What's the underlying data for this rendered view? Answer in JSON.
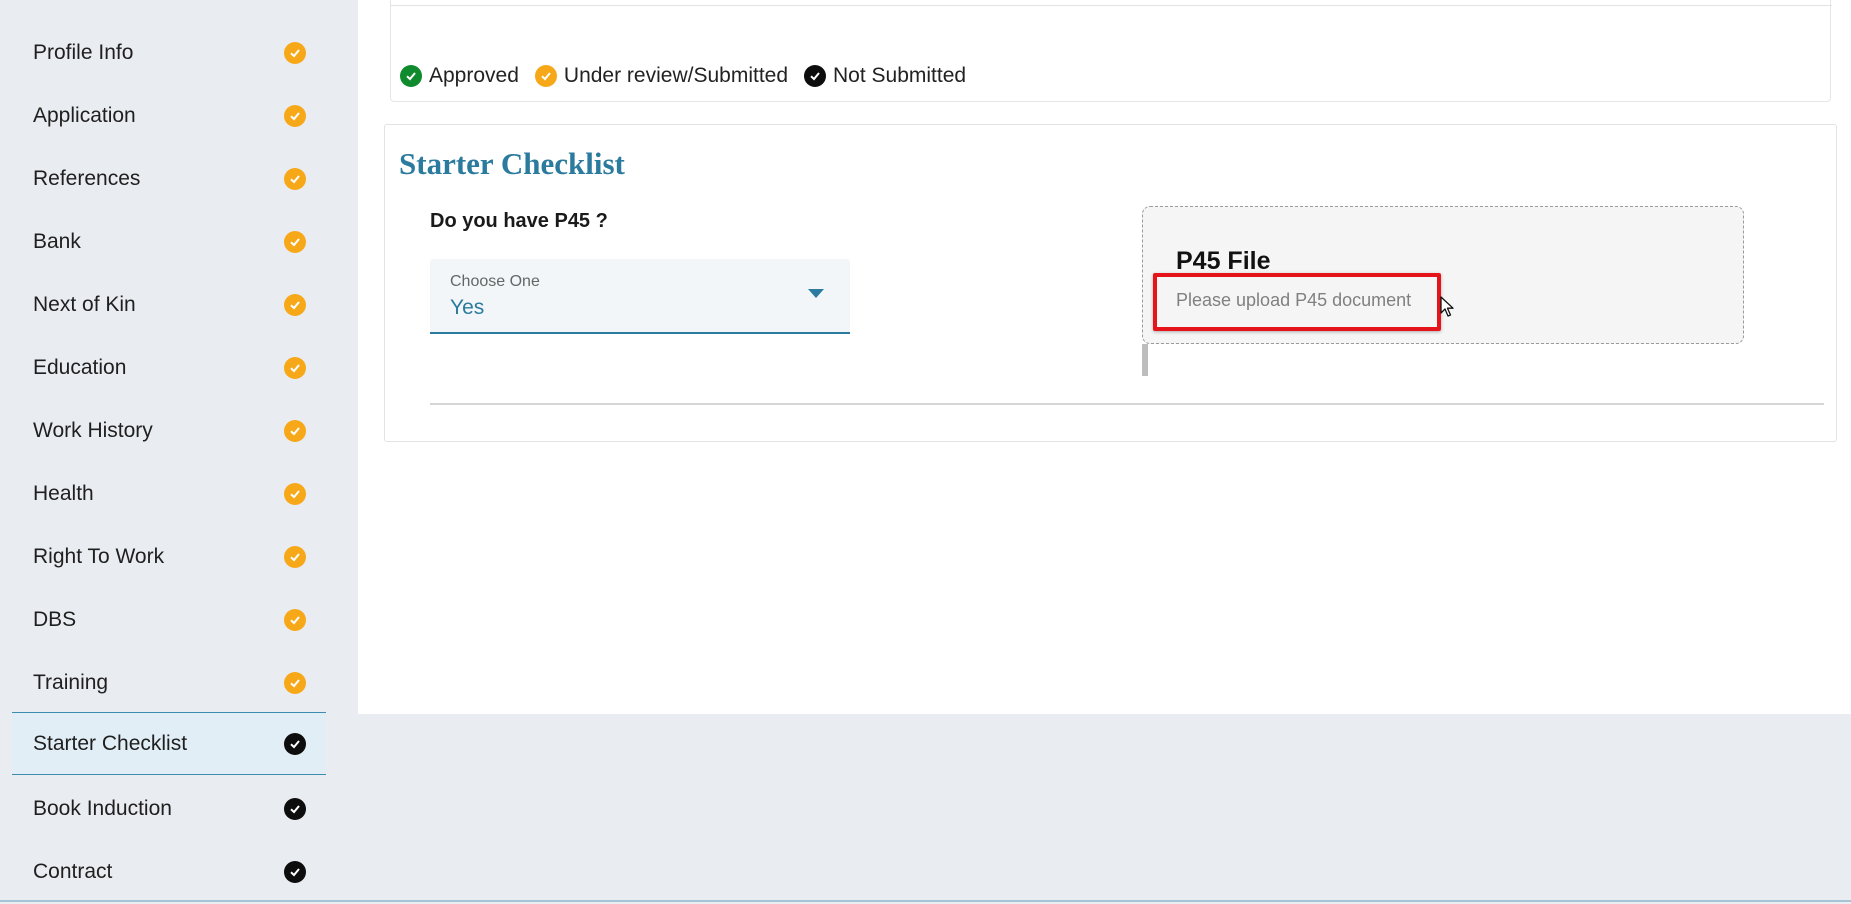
{
  "sidebar": {
    "items": [
      {
        "label": "Profile Info",
        "status": "under-review"
      },
      {
        "label": "Application",
        "status": "under-review"
      },
      {
        "label": "References",
        "status": "under-review"
      },
      {
        "label": "Bank",
        "status": "under-review"
      },
      {
        "label": "Next of Kin",
        "status": "under-review"
      },
      {
        "label": "Education",
        "status": "under-review"
      },
      {
        "label": "Work History",
        "status": "under-review"
      },
      {
        "label": "Health",
        "status": "under-review"
      },
      {
        "label": "Right To Work",
        "status": "under-review"
      },
      {
        "label": "DBS",
        "status": "under-review"
      },
      {
        "label": "Training",
        "status": "under-review"
      },
      {
        "label": "Starter Checklist",
        "status": "not-submitted",
        "active": true
      },
      {
        "label": "Book Induction",
        "status": "not-submitted"
      },
      {
        "label": "Contract",
        "status": "not-submitted"
      }
    ]
  },
  "legend": {
    "approved": "Approved",
    "under_review": "Under review/Submitted",
    "not_submitted": "Not Submitted"
  },
  "checklist": {
    "title": "Starter Checklist",
    "question": "Do you have P45 ?",
    "select_label": "Choose One",
    "select_value": "Yes",
    "upload_title": "P45 File",
    "upload_hint": "Please upload P45 document"
  },
  "colors": {
    "approved": "#0f8a2c",
    "under_review": "#f7a819",
    "not_submitted": "#0d0d0d",
    "accent": "#2b7b9e",
    "highlight": "#e5141b"
  },
  "icons": {
    "status": "check-circle-icon",
    "dropdown": "chevron-down-icon",
    "pointer": "mouse-cursor-icon"
  }
}
